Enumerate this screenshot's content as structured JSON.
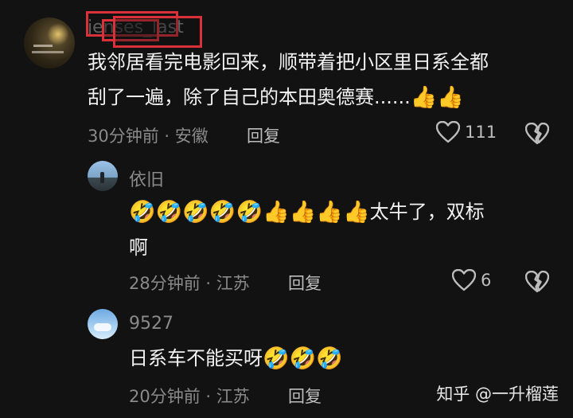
{
  "comments": [
    {
      "username": "jenses_last",
      "content_lines": [
        "我邻居看完电影回来，顺带着把小区里日系全都",
        "刮了一遍，除了自己的本田奥德赛......"
      ],
      "emojis_line2": [
        "👍",
        "👍"
      ],
      "time": "30分钟前",
      "location": "安徽",
      "meta_sep": " · ",
      "reply_label": "回复",
      "like_count": "111",
      "redaction_color": "#d9303a"
    },
    {
      "username": "依旧",
      "emojis_line1": [
        "🤣",
        "🤣",
        "🤣",
        "🤣",
        "🤣",
        "👍",
        "👍",
        "👍",
        "👍"
      ],
      "content_line1_tail": "太牛了，双标",
      "content_line2": "啊",
      "time": "28分钟前",
      "location": "江苏",
      "meta_sep": " · ",
      "reply_label": "回复",
      "like_count": "6"
    },
    {
      "username": "9527",
      "content": "日系车不能买呀",
      "emojis": [
        "🤣",
        "🤣",
        "🤣"
      ],
      "time": "20分钟前",
      "location": "江苏",
      "meta_sep": " · ",
      "reply_label": "回复",
      "like_count": ""
    }
  ],
  "watermark": "知乎 @一升榴莲",
  "icons": {
    "like": "heart-outline-icon",
    "dislike": "broken-heart-icon"
  },
  "colors": {
    "background": "#121212",
    "text": "#f2f2f2",
    "muted": "#8a8a8a",
    "redaction": "#d9303a"
  }
}
